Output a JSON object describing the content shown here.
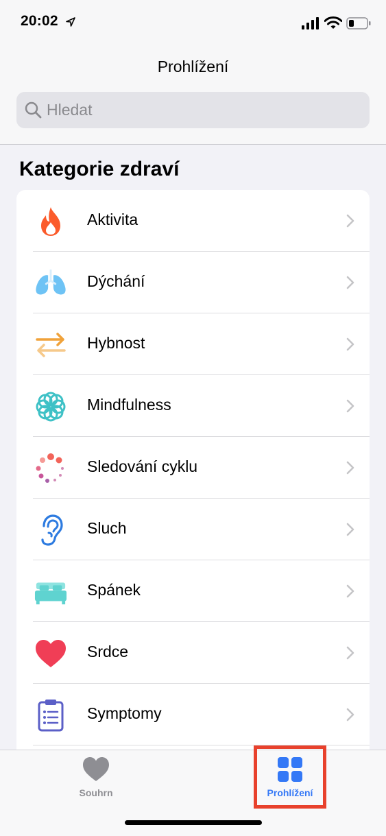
{
  "status_bar": {
    "time": "20:02",
    "icons": [
      "location-arrow-icon",
      "signal-icon",
      "wifi-icon",
      "battery-icon"
    ]
  },
  "header": {
    "title": "Prohlížení"
  },
  "search": {
    "placeholder": "Hledat",
    "value": "",
    "icon": "search-icon"
  },
  "section": {
    "title": "Kategorie zdraví"
  },
  "categories": [
    {
      "label": "Aktivita",
      "icon": "flame-icon",
      "color": "#fb5b2b"
    },
    {
      "label": "Dýchání",
      "icon": "lungs-icon",
      "color": "#6ec3f5"
    },
    {
      "label": "Hybnost",
      "icon": "arrows-icon",
      "color": "#f0a23a"
    },
    {
      "label": "Mindfulness",
      "icon": "flower-icon",
      "color": "#3ec1c6"
    },
    {
      "label": "Sledování cyklu",
      "icon": "cycle-dots-icon",
      "color": "#f2645a"
    },
    {
      "label": "Sluch",
      "icon": "ear-icon",
      "color": "#2d7be0"
    },
    {
      "label": "Spánek",
      "icon": "bed-icon",
      "color": "#5fd3d0"
    },
    {
      "label": "Srdce",
      "icon": "heart-icon",
      "color": "#f03e56"
    },
    {
      "label": "Symptomy",
      "icon": "clipboard-icon",
      "color": "#5b5fc7"
    }
  ],
  "tab_bar": {
    "tabs": [
      {
        "label": "Souhrn",
        "icon": "heart-icon",
        "active": false
      },
      {
        "label": "Prohlížení",
        "icon": "grid-icon",
        "active": true
      }
    ]
  },
  "colors": {
    "accent": "#3478f6",
    "highlight": "#e8412c",
    "inactive": "#8e8e93"
  }
}
